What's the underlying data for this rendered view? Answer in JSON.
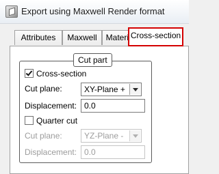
{
  "window": {
    "title": "Export using Maxwell Render format",
    "icon": "export-app-icon"
  },
  "tabs": [
    {
      "label": "Attributes"
    },
    {
      "label": "Maxwell"
    },
    {
      "label": "Material"
    },
    {
      "label": "Cross-section",
      "active": true
    }
  ],
  "accent": {
    "active_tab_outline": "#d40000"
  },
  "cut_part": {
    "title": "Cut part",
    "cross_section": {
      "label": "Cross-section",
      "checked": true
    },
    "cut_plane_label": "Cut plane:",
    "cut_plane_value": "XY-Plane +",
    "displacement_label": "Displacement:",
    "displacement_value": "0.0",
    "quarter_cut": {
      "label": "Quarter cut",
      "checked": false
    },
    "quarter_cut_plane_label": "Cut plane:",
    "quarter_cut_plane_value": "YZ-Plane -",
    "quarter_displacement_label": "Displacement:",
    "quarter_displacement_value": "0.0"
  }
}
